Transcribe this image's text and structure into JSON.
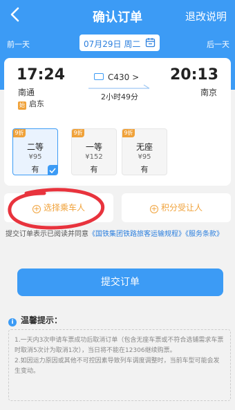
{
  "nav": {
    "title": "确认订单",
    "right": "退改说明"
  },
  "date_bar": {
    "prev": "前一天",
    "date": "07月29日 周二",
    "next": "后一天"
  },
  "train": {
    "dep_time": "17:24",
    "dep_station": "南通",
    "origin_tag": "始",
    "origin": "启东",
    "number": "C430 >",
    "duration": "2小时49分",
    "arr_time": "20:13",
    "arr_station": "南京"
  },
  "seats": [
    {
      "discount": "9折",
      "class": "二等",
      "price": "¥95",
      "avail": "有",
      "selected": true
    },
    {
      "discount": "9折",
      "class": "一等",
      "price": "¥152",
      "avail": "有",
      "selected": false
    },
    {
      "discount": "9折",
      "class": "无座",
      "price": "¥95",
      "avail": "有",
      "selected": false
    }
  ],
  "actions": {
    "select_passenger": "选择乘车人",
    "points_transferee": "积分受让人"
  },
  "agreement": {
    "prefix": "提交订单表示已阅读并同意",
    "link1": "《国铁集团铁路旅客运输规程》",
    "link2": "《服务条款》"
  },
  "submit": "提交订单",
  "tips": {
    "title": "温馨提示：",
    "line1": "1.一天内3次申请车票成功后取消订单（包含无座车票或不符合选铺需求车票时取消5次计为取消1次），当日将不能在12306继续购票。",
    "line2": "2.如因运力原因或其他不可控因素导致列车调度调整时，当前车型可能会发生变动。"
  },
  "colors": {
    "primary": "#3c9bf5",
    "orange": "#f0a23a",
    "circle": "#e8333d"
  }
}
